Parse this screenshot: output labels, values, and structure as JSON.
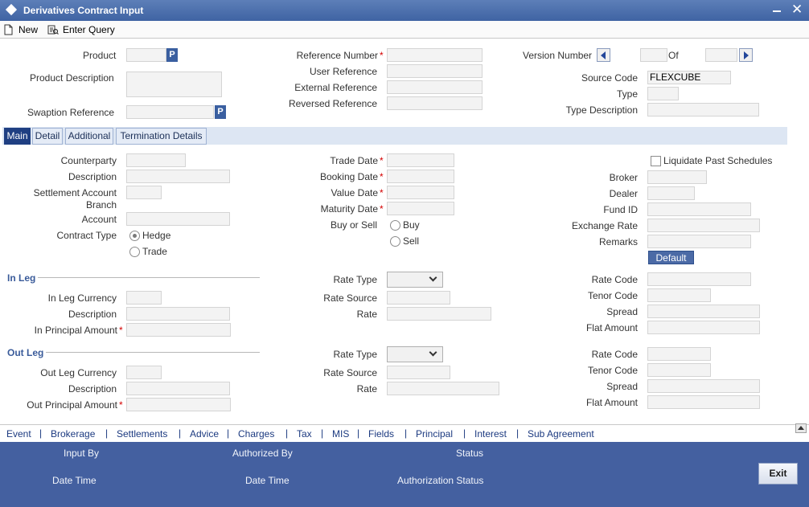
{
  "window": {
    "title": "Derivatives Contract Input"
  },
  "toolbar": {
    "new_label": "New",
    "enter_query_label": "Enter Query"
  },
  "header": {
    "product_label": "Product",
    "product_btn": "P",
    "product_description_label": "Product Description",
    "swaption_reference_label": "Swaption Reference",
    "swaption_btn": "P",
    "reference_number_label": "Reference Number",
    "user_reference_label": "User Reference",
    "external_reference_label": "External Reference",
    "reversed_reference_label": "Reversed Reference",
    "version_number_label": "Version Number",
    "of_label": "Of",
    "source_code_label": "Source Code",
    "source_code_value": "FLEXCUBE",
    "type_label": "Type",
    "type_description_label": "Type Description",
    "required_mark": "*"
  },
  "tabs": [
    {
      "label": "Main"
    },
    {
      "label": "Detail"
    },
    {
      "label": "Additional"
    },
    {
      "label": "Termination Details"
    }
  ],
  "main": {
    "counterparty_label": "Counterparty",
    "description_label": "Description",
    "settlement_account_label": "Settlement Account",
    "branch_label": "Branch",
    "account_label": "Account",
    "contract_type_label": "Contract Type",
    "hedge_label": "Hedge",
    "trade_label": "Trade",
    "trade_date_label": "Trade Date",
    "booking_date_label": "Booking Date",
    "value_date_label": "Value Date",
    "maturity_date_label": "Maturity Date",
    "buy_or_sell_label": "Buy or Sell",
    "buy_label": "Buy",
    "sell_label": "Sell",
    "liquidate_label": "Liquidate Past Schedules",
    "broker_label": "Broker",
    "dealer_label": "Dealer",
    "fund_id_label": "Fund ID",
    "exchange_rate_label": "Exchange Rate",
    "remarks_label": "Remarks",
    "default_label": "Default"
  },
  "in_leg": {
    "section_label": "In Leg",
    "currency_label": "In Leg Currency",
    "description_label": "Description",
    "principal_label": "In Principal Amount",
    "rate_type_label": "Rate Type",
    "rate_source_label": "Rate Source",
    "rate_label": "Rate",
    "rate_code_label": "Rate Code",
    "tenor_code_label": "Tenor Code",
    "spread_label": "Spread",
    "flat_amount_label": "Flat Amount"
  },
  "out_leg": {
    "section_label": "Out Leg",
    "currency_label": "Out Leg Currency",
    "description_label": "Description",
    "principal_label": "Out Principal Amount",
    "rate_type_label": "Rate Type",
    "rate_source_label": "Rate Source",
    "rate_label": "Rate",
    "rate_code_label": "Rate Code",
    "tenor_code_label": "Tenor Code",
    "spread_label": "Spread",
    "flat_amount_label": "Flat Amount"
  },
  "links": [
    "Event",
    "Brokerage",
    "Settlements",
    "Advice",
    "Charges",
    "Tax",
    "MIS",
    "Fields",
    "Principal",
    "Interest",
    "Sub Agreement"
  ],
  "link_separator": "|",
  "footer": {
    "input_by_label": "Input By",
    "date_time_label": "Date Time",
    "authorized_by_label": "Authorized By",
    "date_time2_label": "Date Time",
    "status_label": "Status",
    "authorization_status_label": "Authorization Status",
    "exit_label": "Exit"
  }
}
